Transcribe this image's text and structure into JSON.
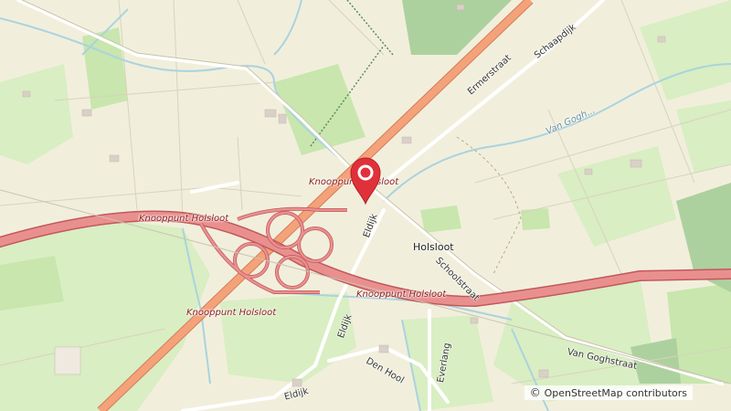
{
  "labels": {
    "junction_main": "Knooppunt Holsloot",
    "junction_west": "Knooppunt Holsloot",
    "junction_east": "Knooppunt Holsloot",
    "junction_south": "Knooppunt Holsloot",
    "village": "Holsloot",
    "street_ermer": "Ermerstraat",
    "street_schaap": "Schaapdijk",
    "street_eldijk_north": "Eldijk",
    "street_eldijk_mid": "Eldijk",
    "street_eldijk_south": "Eldijk",
    "street_school": "Schoolstraat",
    "street_vangogh": "Van Goghstraat",
    "street_everlang": "Everlang",
    "street_denhool": "Den Hool",
    "waterway": "Van Gogh..."
  },
  "attribution": {
    "symbol": "©",
    "text": "OpenStreetMap contributors"
  },
  "colors": {
    "motorway": "#e9908f",
    "trunk": "#f4a27a",
    "land": "#f1efdc",
    "grass": "#cdebb0",
    "forest": "#add19e",
    "water": "#aad3df",
    "marker": "#e0313a"
  }
}
